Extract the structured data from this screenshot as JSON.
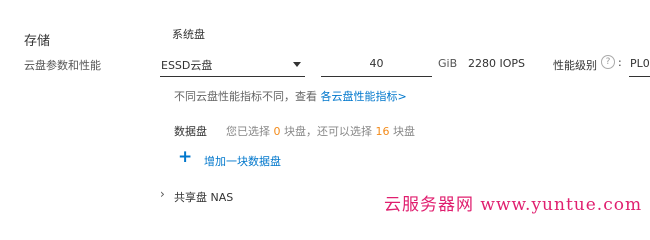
{
  "section": {
    "title": "存储",
    "subtitle": "云盘参数和性能"
  },
  "system_disk": {
    "label": "系统盘",
    "type_selected": "ESSD云盘",
    "size_value": "40",
    "unit": "GiB",
    "iops": "2280 IOPS",
    "perf_label": "性能级别",
    "perf_value": "PL0",
    "hint_text": "不同云盘性能指标不同，查看 ",
    "hint_link": "各云盘性能指标>"
  },
  "data_disk": {
    "label": "数据盘",
    "summary_prefix": "您已选择 ",
    "selected_count": "0",
    "summary_mid": " 块盘，还可以选择 ",
    "remaining_count": "16",
    "summary_suffix": " 块盘",
    "add_button_label": "增加一块数据盘"
  },
  "shared_disk": {
    "label": "共享盘 NAS"
  },
  "watermark": {
    "text": "云服务器网 www.yuntue.com"
  },
  "colors": {
    "link": "#0077cc",
    "count_highlight": "#f38b1b",
    "watermark": "#e01f6f"
  }
}
